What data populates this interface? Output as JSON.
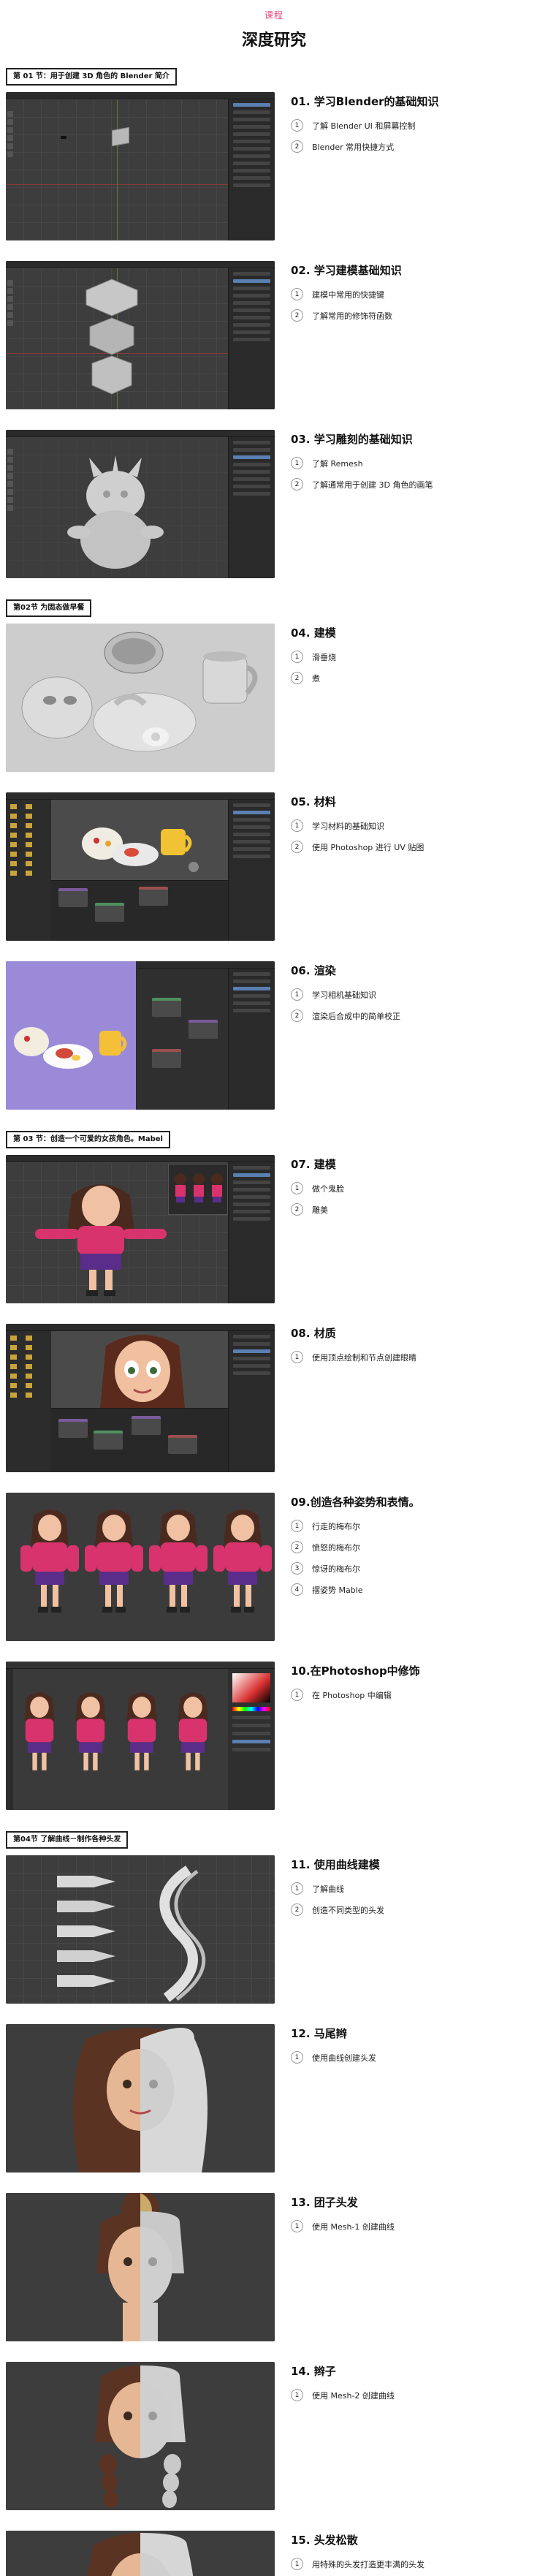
{
  "header": {
    "kicker": "课程",
    "title": "深度研究"
  },
  "sections": [
    {
      "tag": "第 01 节：用于创建 3D 角色的 Blender 简介",
      "lessons": [
        {
          "title": "01. 学习Blender的基础知识",
          "items": [
            "了解 Blender UI 和屏幕控制",
            "Blender 常用快捷方式"
          ]
        },
        {
          "title": "02. 学习建模基础知识",
          "items": [
            "建模中常用的快捷键",
            "了解常用的修饰符函数"
          ]
        },
        {
          "title": "03. 学习雕刻的基础知识",
          "items": [
            "了解 Remesh",
            "了解通常用于创建 3D 角色的画笔"
          ]
        }
      ]
    },
    {
      "tag": "第02节 为固态做早餐",
      "lessons": [
        {
          "title": "04. 建模",
          "items": [
            "滑垂烧",
            "煮"
          ]
        },
        {
          "title": "05. 材料",
          "items": [
            "学习材料的基础知识",
            "使用 Photoshop 进行 UV 贴图"
          ]
        },
        {
          "title": "06. 渲染",
          "items": [
            "学习相机基础知识",
            "渲染后合成中的简单校正"
          ]
        }
      ]
    },
    {
      "tag": "第 03 节：创造一个可爱的女孩角色。Mabel",
      "lessons": [
        {
          "title": "07. 建模",
          "items": [
            "做个鬼脸",
            "雕美"
          ]
        },
        {
          "title": "08. 材质",
          "items": [
            "使用顶点绘制和节点创建眼睛"
          ]
        },
        {
          "title": "09.创造各种姿势和表情。",
          "items": [
            "行走的梅布尔",
            "愤怒的梅布尔",
            "惊讶的梅布尔",
            "摆姿势 Mable"
          ]
        },
        {
          "title": "10.在Photoshop中修饰",
          "items": [
            "在 Photoshop 中编辑"
          ]
        }
      ]
    },
    {
      "tag": "第04节 了解曲线－制作各种头发",
      "lessons": [
        {
          "title": "11. 使用曲线建模",
          "items": [
            "了解曲线",
            "创造不同类型的头发"
          ]
        },
        {
          "title": "12. 马尾辫",
          "items": [
            "使用曲线创建头发"
          ]
        },
        {
          "title": "13. 团子头发",
          "items": [
            "使用 Mesh-1 创建曲线"
          ]
        },
        {
          "title": "14. 辫子",
          "items": [
            "使用 Mesh-2 创建曲线"
          ]
        },
        {
          "title": "15. 头发松散",
          "items": [
            "用特殊的头发打造更丰满的头发"
          ]
        }
      ]
    }
  ],
  "colors": {
    "kicker": "#e24b7a",
    "viewport": "#3d3d3d",
    "accent_purple": "#9a8ad8"
  }
}
